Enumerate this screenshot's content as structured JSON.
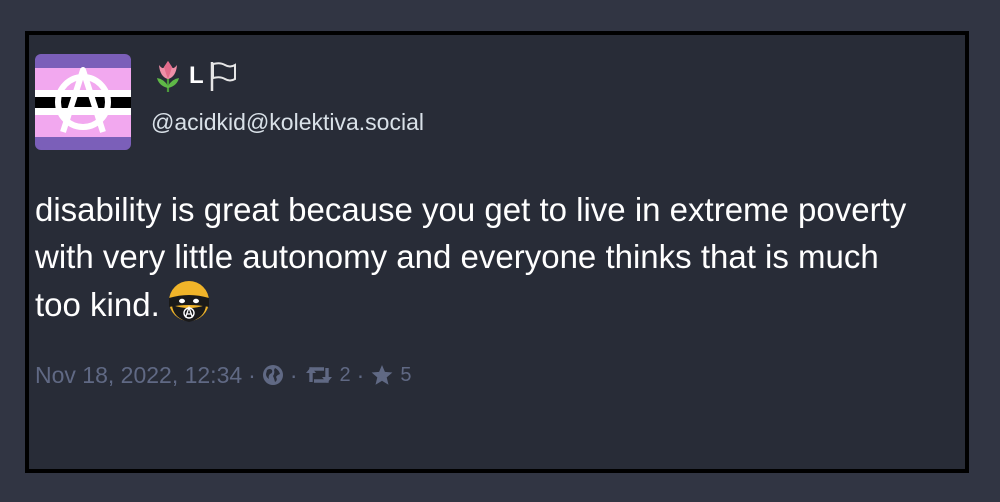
{
  "post": {
    "display_name_letter": "L",
    "display_name_icons": [
      "tulip-icon",
      "white-flag-icon"
    ],
    "handle": "@acidkid@kolektiva.social",
    "text": "disability is great because you get to live in extreme poverty with very little autonomy and everyone thinks that is much too kind.",
    "trailing_emoji": "anarchist-masked-face-emoji",
    "avatar_icon": "anarchy-symbol-icon",
    "timestamp": "Nov 18, 2022, 12:34",
    "visibility_icon": "globe-icon",
    "boost_count": "2",
    "favourite_count": "5",
    "separator": "·"
  },
  "colors": {
    "page_background": "#313543",
    "card_background": "#282c37",
    "card_border": "#000000",
    "text_primary": "#ffffff",
    "text_handle": "#d9e1e8",
    "text_meta": "#606984",
    "avatar_stripe_purple": "#7b5fb9",
    "avatar_stripe_pink": "#f2a8ef",
    "avatar_stripe_black": "#000000"
  }
}
